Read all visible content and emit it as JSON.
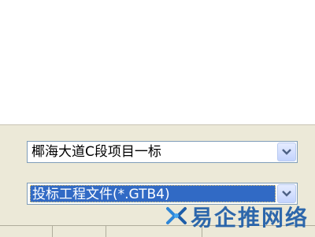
{
  "project_name": {
    "value": "椰海大道C段项目一标"
  },
  "file_type": {
    "value": "投标工程文件(*.GTB4)"
  },
  "table_headers": [
    "",
    "",
    ""
  ],
  "brand": {
    "text": "易企推网络",
    "accent": "#1d5da8"
  },
  "colors": {
    "dialog_bg": "#ece9d8",
    "selection": "#316ac5",
    "combo_border": "#7f9db9"
  }
}
